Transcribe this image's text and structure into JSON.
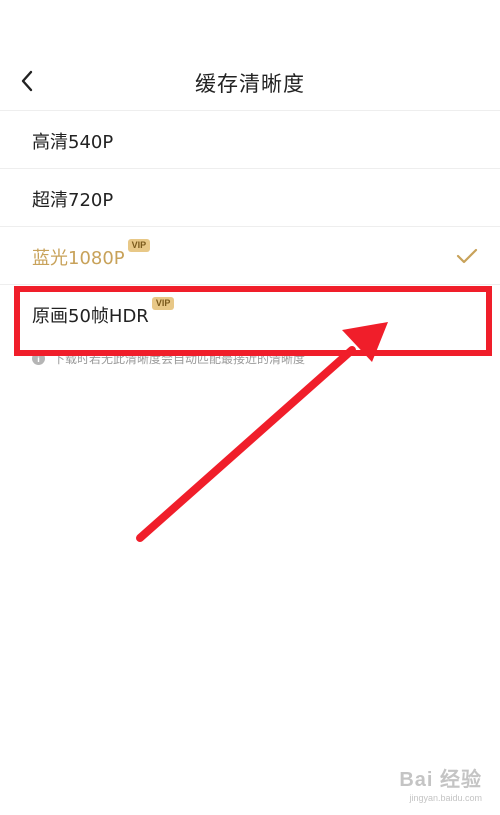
{
  "header": {
    "title": "缓存清晰度"
  },
  "options": [
    {
      "label": "高清540P",
      "vip": false,
      "selected": false
    },
    {
      "label": "超清720P",
      "vip": false,
      "selected": false
    },
    {
      "label": "蓝光1080P",
      "vip": true,
      "selected": true
    },
    {
      "label": "原画50帧HDR",
      "vip": true,
      "selected": false
    }
  ],
  "vip_badge_label": "VIP",
  "hint": "下载时若无此清晰度会自动匹配最接近的清晰度",
  "colors": {
    "accent": "#c8a25a",
    "highlight": "#f01e2a",
    "vip_badge": "#e8c887"
  },
  "watermark": {
    "main": "Bai 经验",
    "sub": "jingyan.baidu.com"
  }
}
